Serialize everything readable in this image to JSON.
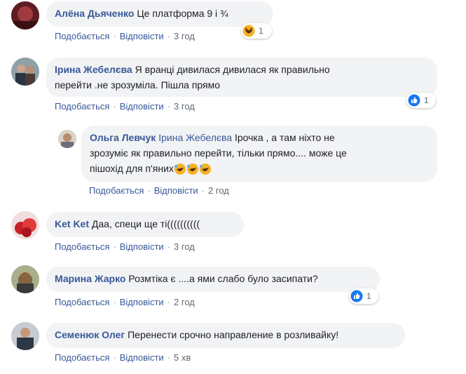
{
  "comments": [
    {
      "author": "Алёна Дьяченко",
      "text": "Це платформа 9 і ¾",
      "actions": {
        "like": "Подобається",
        "reply": "Відповісти",
        "time": "3 год"
      },
      "reaction": {
        "type": "haha-icon",
        "count": "1"
      }
    },
    {
      "author": "Ірина Жебелєва",
      "text_line1": "Я вранці дивилася дивилася як правильно",
      "text_line2": "перейти .не зрозуміла. Пішла прямо",
      "actions": {
        "like": "Подобається",
        "reply": "Відповісти",
        "time": "3 год"
      },
      "reaction": {
        "type": "like-icon",
        "count": "1"
      }
    },
    {
      "author": "Ольга Левчук",
      "mention": "Ірина Жебелєва",
      "text_line1": "Ірочка , а там ніхто не",
      "text_line2": "зрозуміє як правильно перейти, тільки прямо.... може це",
      "text_line3": "пішохід для п'яних",
      "actions": {
        "like": "Подобається",
        "reply": "Відповісти",
        "time": "2 год"
      }
    },
    {
      "author": "Ket Ket",
      "text": "Даа, специ ще ті((((((((((",
      "actions": {
        "like": "Подобається",
        "reply": "Відповісти",
        "time": "3 год"
      }
    },
    {
      "author": "Марина Жарко",
      "text": "Розмтіка є ....а ями слабо було засипати?",
      "actions": {
        "like": "Подобається",
        "reply": "Відповісти",
        "time": "2 год"
      },
      "reaction": {
        "type": "like-icon",
        "count": "1"
      }
    },
    {
      "author": "Семенюк Олег",
      "text": "Перенести срочно направление в розливайку!",
      "actions": {
        "like": "Подобається",
        "reply": "Відповісти",
        "time": "5 хв"
      }
    }
  ],
  "colors": {
    "link": "#385898",
    "bubble": "#f2f3f5",
    "meta": "#606770",
    "like": "#1877f2",
    "haha": "#f7b125"
  }
}
